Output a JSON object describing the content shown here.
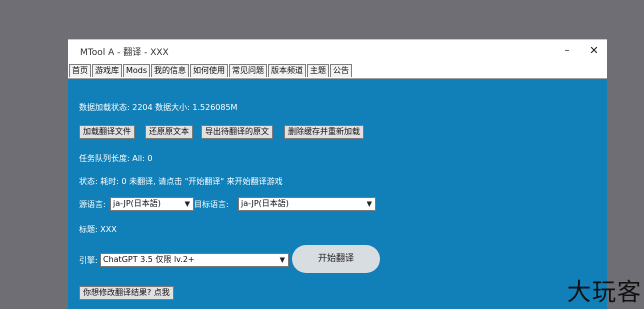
{
  "window": {
    "title": "MTool A - 翻译 - XXX",
    "minimize_glyph": "–",
    "close_glyph": "✕"
  },
  "tabs": [
    {
      "label": "首页",
      "active": false
    },
    {
      "label": "游戏库",
      "active": false
    },
    {
      "label": "Mods",
      "active": false
    },
    {
      "label": "我的信息",
      "active": false
    },
    {
      "label": "如何使用",
      "active": false
    },
    {
      "label": "常见问题",
      "active": false
    },
    {
      "label": "版本频道",
      "active": false
    },
    {
      "label": "主题",
      "active": false
    },
    {
      "label": "公告",
      "active": false
    }
  ],
  "content": {
    "data_status": "数据加载状态: 2204 数据大小: 1.526085M",
    "buttons": {
      "load_file": "加载翻译文件",
      "restore_text": "还原原文本",
      "export_text": "导出待翻译的原文",
      "delete_cache": "删除缓存并重新加载"
    },
    "queue_length": "任务队列长度: All: 0",
    "status_line": "状态: 耗时: 0 未翻译, 请点击 \"开始翻译\" 来开始翻译游戏",
    "source_label": "源语言:",
    "source_value": "ja-JP(日本語)",
    "target_label": "目标语言:",
    "target_value": "ja-JP(日本語)",
    "title_line": "标题: XXX",
    "engine_label": "引擎:",
    "engine_value": "ChatGPT 3.5 仅限 lv.2+",
    "start_button": "开始翻译",
    "edit_button": "你想修改翻译结果? 点我"
  },
  "watermark": "大玩客",
  "colors": {
    "desktop": "#6f6e75",
    "window_body": "#1180b9",
    "titlebar": "#ffffff"
  }
}
